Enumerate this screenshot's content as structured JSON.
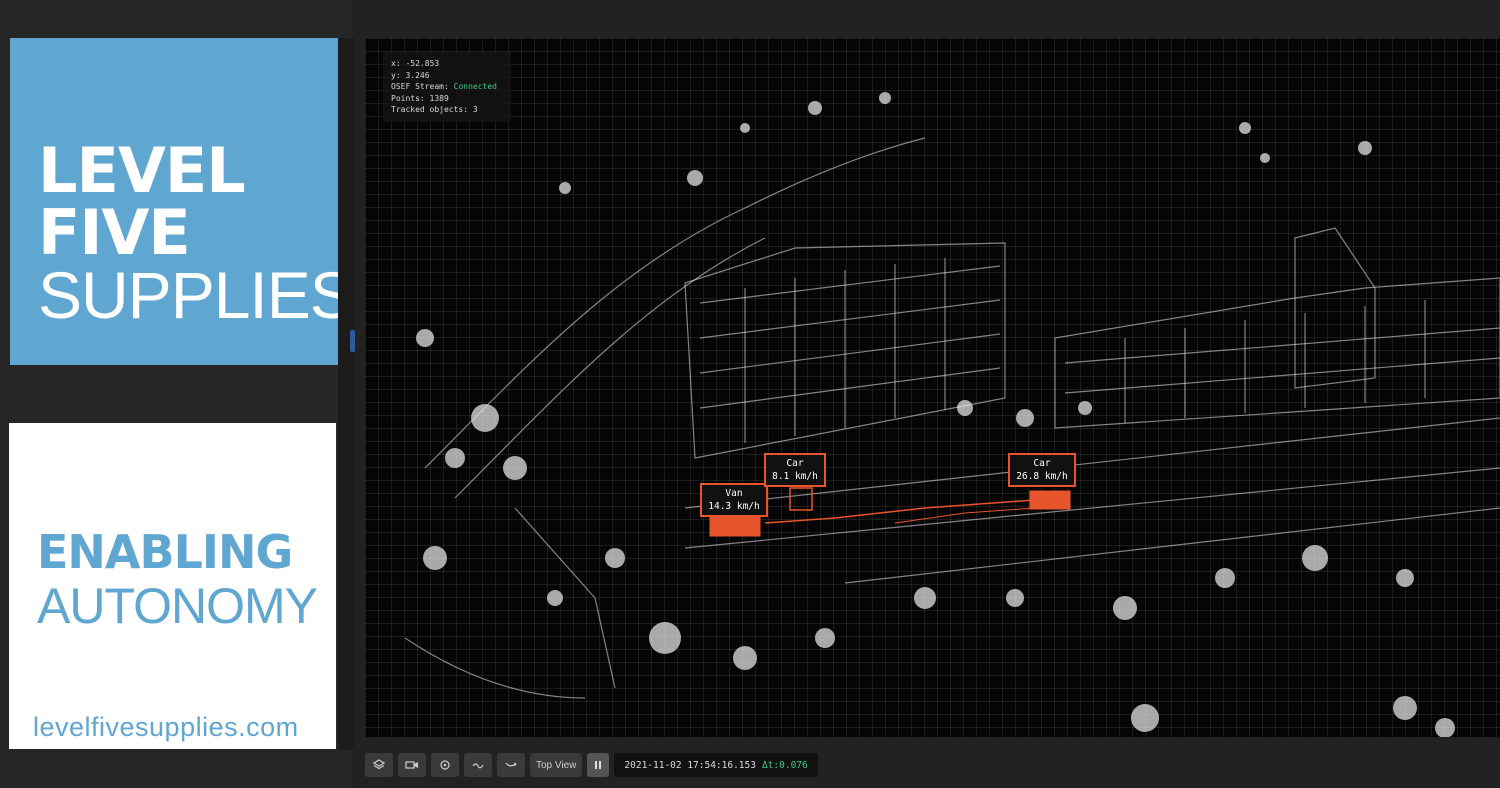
{
  "brand": {
    "line1": "LEVEL",
    "line2": "FIVE",
    "line3": "SUPPLIES",
    "tagline1": "ENABLING",
    "tagline2": "AUTONOMY",
    "url": "levelfivesupplies.com",
    "accent": "#5fa6d1"
  },
  "readout": {
    "x_label": "x:",
    "x_value": "-52.853",
    "y_label": "y:",
    "y_value": "3.246",
    "stream_label": "OSEF Stream:",
    "stream_status": "Connected",
    "points_label": "Points:",
    "points_value": "1389",
    "tracked_label": "Tracked objects:",
    "tracked_value": "3"
  },
  "objects": [
    {
      "class": "Van",
      "speed": "14.3 km/h"
    },
    {
      "class": "Car",
      "speed": "8.1 km/h"
    },
    {
      "class": "Car",
      "speed": "26.8 km/h"
    }
  ],
  "toolbar": {
    "icons": [
      "layers-icon",
      "camera-icon",
      "target-icon",
      "path-icon",
      "trajectory-icon"
    ],
    "view_label": "Top View",
    "timestamp": "2021-11-02 17:54:16.153",
    "delta_label": "Δt:",
    "delta_value": "0.076"
  },
  "colors": {
    "tracked_object": "#e8542b",
    "status_ok": "#3fc98a"
  }
}
